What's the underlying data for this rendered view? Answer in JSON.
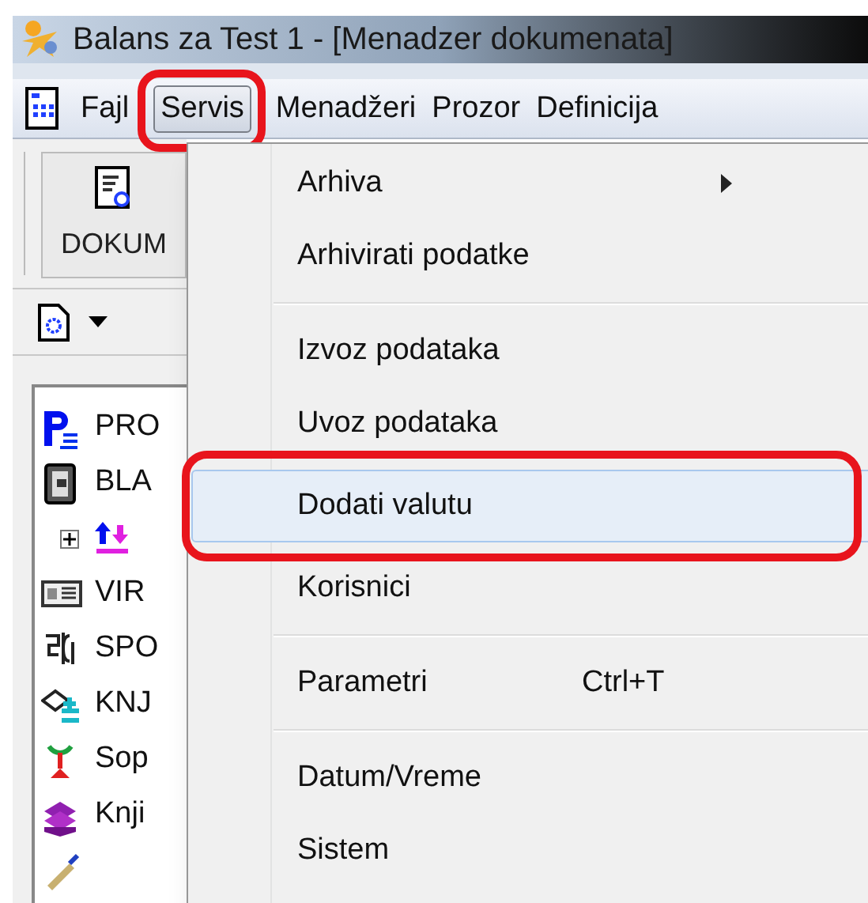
{
  "window": {
    "title": "Balans za Test 1 - [Menadzer dokumenata]"
  },
  "menu_bar": {
    "items": [
      {
        "label": "Fajl",
        "selected": false,
        "annotated": false
      },
      {
        "label": "Servis",
        "selected": true,
        "annotated": true
      },
      {
        "label": "Menadžeri",
        "selected": false,
        "annotated": false
      },
      {
        "label": "Prozor",
        "selected": false,
        "annotated": false
      },
      {
        "label": "Definicija",
        "selected": false,
        "annotated": false
      }
    ]
  },
  "toolbar": {
    "button": "DOKUM"
  },
  "tree": {
    "items": [
      {
        "label": "PRO",
        "kind": "p"
      },
      {
        "label": "BLA",
        "kind": "safe"
      },
      {
        "kind": "transfer",
        "expandable": true
      },
      {
        "label": "VIR",
        "kind": "card"
      },
      {
        "label": "SPO",
        "kind": "sign"
      },
      {
        "label": "KNJ",
        "kind": "book"
      },
      {
        "label": "Sop",
        "kind": "tree"
      },
      {
        "label": "Knji",
        "kind": "books"
      },
      {
        "kind": "pen"
      }
    ]
  },
  "dropdown_menu": {
    "items": [
      {
        "label": "Arhiva",
        "submenu": true,
        "selected": false,
        "annotated": false
      },
      {
        "label": "Arhivirati podatke",
        "selected": false,
        "annotated": false
      },
      {
        "kind": "separator"
      },
      {
        "label": "Izvoz podataka",
        "selected": false,
        "annotated": false
      },
      {
        "label": "Uvoz podataka",
        "selected": false,
        "annotated": false
      },
      {
        "label": "Dodati valutu",
        "selected": true,
        "annotated": true
      },
      {
        "label": "Korisnici",
        "selected": false,
        "annotated": false
      },
      {
        "kind": "separator"
      },
      {
        "label": "Parametri",
        "shortcut": "Ctrl+T",
        "selected": false,
        "annotated": false
      },
      {
        "kind": "separator"
      },
      {
        "label": "Datum/Vreme",
        "selected": false,
        "annotated": false
      },
      {
        "label": "Sistem",
        "selected": false,
        "annotated": false
      }
    ]
  }
}
